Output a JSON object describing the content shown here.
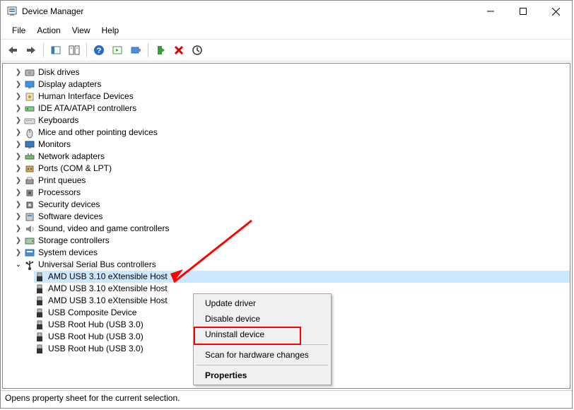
{
  "window": {
    "title": "Device Manager"
  },
  "menus": {
    "file": "File",
    "action": "Action",
    "view": "View",
    "help": "Help"
  },
  "tree": {
    "items": [
      {
        "label": "Disk drives",
        "icon": "disk-icon"
      },
      {
        "label": "Display adapters",
        "icon": "display-icon"
      },
      {
        "label": "Human Interface Devices",
        "icon": "hid-icon"
      },
      {
        "label": "IDE ATA/ATAPI controllers",
        "icon": "ide-icon"
      },
      {
        "label": "Keyboards",
        "icon": "keyboard-icon"
      },
      {
        "label": "Mice and other pointing devices",
        "icon": "mouse-icon"
      },
      {
        "label": "Monitors",
        "icon": "monitor-icon"
      },
      {
        "label": "Network adapters",
        "icon": "network-icon"
      },
      {
        "label": "Ports (COM & LPT)",
        "icon": "ports-icon"
      },
      {
        "label": "Print queues",
        "icon": "printer-icon"
      },
      {
        "label": "Processors",
        "icon": "cpu-icon"
      },
      {
        "label": "Security devices",
        "icon": "security-icon"
      },
      {
        "label": "Software devices",
        "icon": "software-icon"
      },
      {
        "label": "Sound, video and game controllers",
        "icon": "sound-icon"
      },
      {
        "label": "Storage controllers",
        "icon": "storage-icon"
      },
      {
        "label": "System devices",
        "icon": "system-icon"
      }
    ],
    "expanded": {
      "label": "Universal Serial Bus controllers",
      "icon": "usb-icon",
      "children": [
        {
          "label": "AMD USB 3.10 eXtensible Host",
          "trunc": true
        },
        {
          "label": "AMD USB 3.10 eXtensible Host",
          "trunc": true
        },
        {
          "label": "AMD USB 3.10 eXtensible Host",
          "trunc": true
        },
        {
          "label": "USB Composite Device"
        },
        {
          "label": "USB Root Hub (USB 3.0)"
        },
        {
          "label": "USB Root Hub (USB 3.0)"
        },
        {
          "label": "USB Root Hub (USB 3.0)"
        }
      ]
    }
  },
  "context_menu": {
    "update": "Update driver",
    "disable": "Disable device",
    "uninstall": "Uninstall device",
    "scan": "Scan for hardware changes",
    "properties": "Properties"
  },
  "status": "Opens property sheet for the current selection."
}
